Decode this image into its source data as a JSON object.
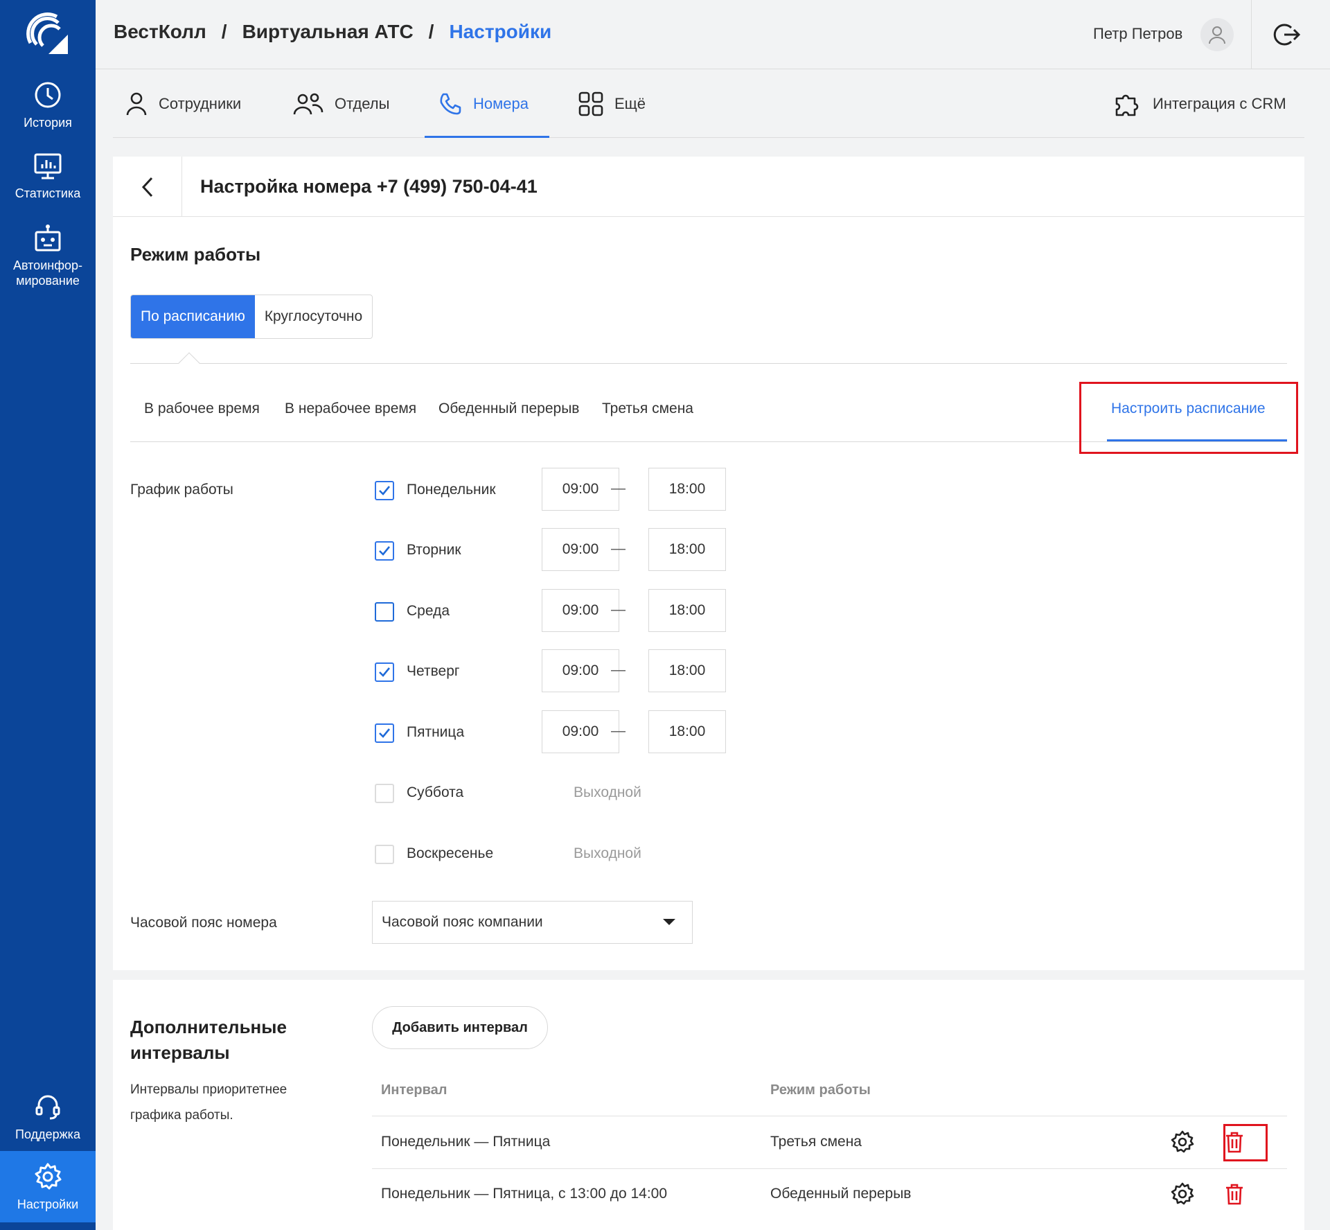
{
  "sidebar": {
    "items": [
      {
        "label": "История",
        "icon": "clock-icon"
      },
      {
        "label": "Статистика",
        "icon": "chart-monitor-icon"
      },
      {
        "label": "Автоинфор-",
        "label2": "мирование",
        "icon": "robot-icon"
      },
      {
        "label": "Поддержка",
        "icon": "headset-icon"
      },
      {
        "label": "Настройки",
        "icon": "gear-icon",
        "active": true
      }
    ]
  },
  "header": {
    "breadcrumb": [
      "ВестКолл",
      "Виртуальная АТС",
      "Настройки"
    ],
    "user_name": "Петр Петров"
  },
  "tabs": {
    "items": [
      {
        "label": "Сотрудники",
        "icon": "user-icon"
      },
      {
        "label": "Отделы",
        "icon": "users-icon"
      },
      {
        "label": "Номера",
        "icon": "phone-icon",
        "active": true
      },
      {
        "label": "Ещё",
        "icon": "grid-icon"
      }
    ],
    "crm": {
      "label": "Интеграция с CRM",
      "icon": "puzzle-icon"
    }
  },
  "card": {
    "title": "Настройка номера +7 (499) 750-04-41",
    "mode_title": "Режим работы",
    "mode_options": [
      "По расписанию",
      "Круглосуточно"
    ],
    "mode_selected": "По расписанию",
    "subtabs": [
      "В рабочее время",
      "В нерабочее время",
      "Обеденный перерыв",
      "Третья смена",
      "Настроить расписание"
    ],
    "subtab_active": "Настроить расписание",
    "schedule_label": "График работы",
    "days": [
      {
        "name": "Понедельник",
        "checked": true,
        "from": "09:00",
        "to": "18:00"
      },
      {
        "name": "Вторник",
        "checked": true,
        "from": "09:00",
        "to": "18:00"
      },
      {
        "name": "Среда",
        "checked": false,
        "from": "09:00",
        "to": "18:00"
      },
      {
        "name": "Четверг",
        "checked": true,
        "from": "09:00",
        "to": "18:00"
      },
      {
        "name": "Пятница",
        "checked": true,
        "from": "09:00",
        "to": "18:00"
      },
      {
        "name": "Суббота",
        "checked": false,
        "dayoff": "Выходной"
      },
      {
        "name": "Воскресенье",
        "checked": false,
        "dayoff": "Выходной"
      }
    ],
    "dash": "—",
    "timezone_label": "Часовой пояс номера",
    "timezone_value": "Часовой пояс компании"
  },
  "intervals": {
    "title": "Дополнительные интервалы",
    "description": "Интервалы приоритетнее графика работы.",
    "add_button": "Добавить интервал",
    "columns": [
      "Интервал",
      "Режим работы"
    ],
    "rows": [
      {
        "interval": "Понедельник — Пятница",
        "mode": "Третья смена"
      },
      {
        "interval": "Понедельник — Пятница, с 13:00 до 14:00",
        "mode": "Обеденный перерыв"
      }
    ]
  },
  "colors": {
    "sidebar": "#0b4599",
    "accent": "#2f74e8",
    "danger": "#e0141e"
  }
}
